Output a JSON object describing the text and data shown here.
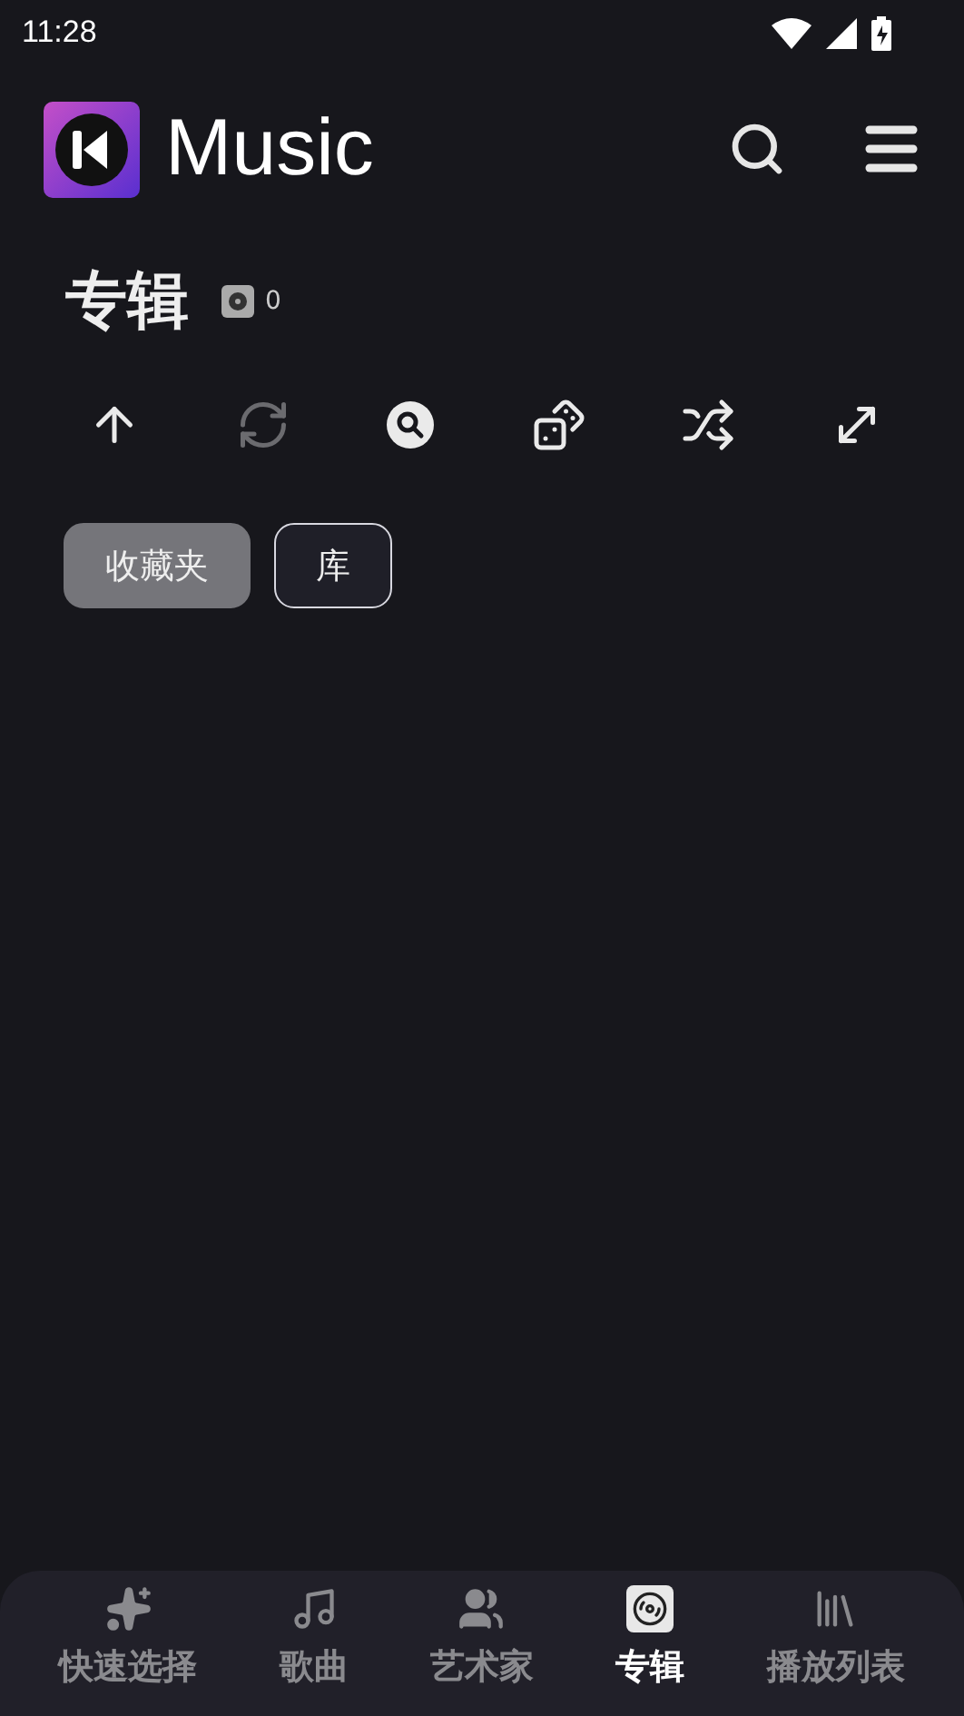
{
  "status_bar": {
    "time": "11:28"
  },
  "app_bar": {
    "title": "Music"
  },
  "section": {
    "title": "专辑",
    "count": "0"
  },
  "toolbar": [
    {
      "kind": "up",
      "disabled": false
    },
    {
      "kind": "refresh",
      "disabled": true
    },
    {
      "kind": "search",
      "disabled": false
    },
    {
      "kind": "dice",
      "disabled": false
    },
    {
      "kind": "shuffle",
      "disabled": false
    },
    {
      "kind": "expand",
      "disabled": false
    }
  ],
  "filters": [
    {
      "label": "收藏夹",
      "selected": true
    },
    {
      "label": "库",
      "selected": false
    }
  ],
  "nav": [
    {
      "kind": "quick",
      "label": "快速选择",
      "selected": false
    },
    {
      "kind": "songs",
      "label": "歌曲",
      "selected": false
    },
    {
      "kind": "artists",
      "label": "艺术家",
      "selected": false
    },
    {
      "kind": "albums",
      "label": "专辑",
      "selected": true
    },
    {
      "kind": "playlists",
      "label": "播放列表",
      "selected": false
    }
  ]
}
